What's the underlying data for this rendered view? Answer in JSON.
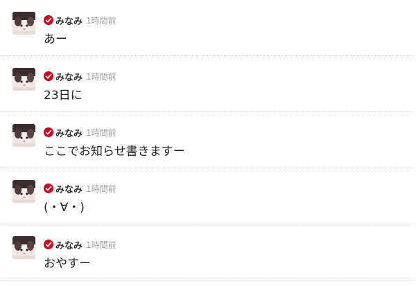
{
  "feed": {
    "posts": [
      {
        "author": "みなみ",
        "time": "1時間前",
        "message": "あー"
      },
      {
        "author": "みなみ",
        "time": "1時間前",
        "message": "23日に"
      },
      {
        "author": "みなみ",
        "time": "1時間前",
        "message": "ここでお知らせ書きますー"
      },
      {
        "author": "みなみ",
        "time": "1時間前",
        "message": "(・∀・)"
      },
      {
        "author": "みなみ",
        "time": "1時間前",
        "message": "おやすー"
      }
    ]
  },
  "icons": {
    "verified": "verified-check-icon",
    "avatar": "user-avatar"
  },
  "colors": {
    "verified_badge": "#d0021b",
    "author_text": "#333333",
    "time_text": "#a0a0a0",
    "message_text": "#222222",
    "divider": "#cfcfcf"
  }
}
